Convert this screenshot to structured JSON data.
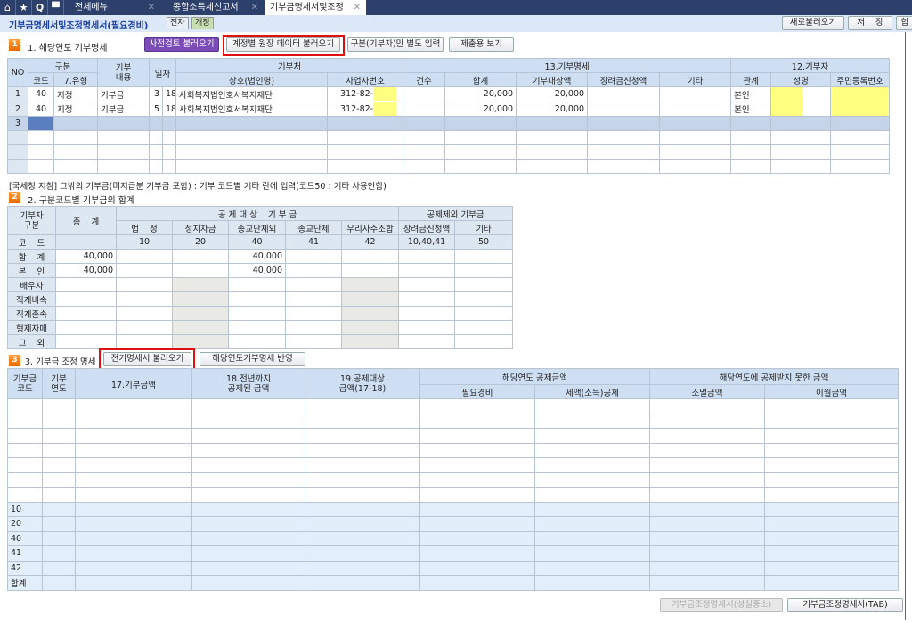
{
  "tabbar": {
    "icons": [
      "home-icon",
      "star-icon",
      "search-icon",
      "calendar-icon"
    ],
    "tabs": [
      {
        "label": "전체메뉴"
      },
      {
        "label": "종합소득세신고서"
      },
      {
        "label": "기부금명세서및조정"
      }
    ]
  },
  "header": {
    "title": "기부금명세서및조정명세서(필요경비)",
    "badge1": "전자",
    "badge2": "개정",
    "reload": "새로불러오기",
    "save": "저    장",
    "sum": "합"
  },
  "section1": {
    "no": "1",
    "title": "1. 해당연도 기부명세",
    "btn_precheck": "사전검토 불러오기",
    "btn_ledger": "계정별 원장 데이터 불러오기",
    "btn_separate": "구분(기부자)만 별도 입력",
    "btn_view": "제출용 보기",
    "headers": {
      "no": "NO",
      "gubun": "구분",
      "code": "코드",
      "type": "7.유형",
      "content": "기부\n내용",
      "date": "일자",
      "org": "기부처",
      "name": "상호(법인명)",
      "bizno": "사업자번호",
      "detail": "13.기부명세",
      "count": "건수",
      "total": "합계",
      "target": "기부대상액",
      "scholar": "장려금신청액",
      "etc": "기타",
      "donor": "12.기부자",
      "rel": "관계",
      "dname": "성명",
      "rrn": "주민등록번호"
    },
    "rows": [
      {
        "no": "1",
        "code": "40",
        "type": "지정",
        "content": "기부금",
        "month": "3",
        "day": "18",
        "name": "사회복지법인호서복지재단",
        "bizno": "312-82-",
        "count": "",
        "total": "20,000",
        "target": "20,000",
        "scholar": "",
        "etc": "",
        "rel": "본인"
      },
      {
        "no": "2",
        "code": "40",
        "type": "지정",
        "content": "기부금",
        "month": "5",
        "day": "18",
        "name": "사회복지법인호서복지재단",
        "bizno": "312-82-",
        "count": "",
        "total": "20,000",
        "target": "20,000",
        "scholar": "",
        "etc": "",
        "rel": "본인"
      },
      {
        "no": "3"
      }
    ]
  },
  "notice": "[국세청 지침] 그밖의 기부금(미지급분 기부금 포함) : 기부 코드별 기타 란에 입력(코드50 : 기타 사용안함)",
  "section2": {
    "no": "2",
    "title": "2. 구분코드별 기부금의 합계",
    "headers": {
      "donor": "기부자\n구분",
      "total": "총    계",
      "deductible": "공 제 대 상    기 부 금",
      "excluded": "공제제외 기부금",
      "cols": [
        "법    정",
        "정치자금",
        "종교단체외",
        "종교단체",
        "우리사주조합",
        "장려금신청액",
        "기타"
      ]
    },
    "code_label": "코    드",
    "codes": [
      "10",
      "20",
      "40",
      "41",
      "42",
      "10,40,41",
      "50"
    ],
    "rows": [
      {
        "label": "합    계",
        "vals": [
          "40,000",
          "",
          "",
          "40,000",
          "",
          "",
          "",
          ""
        ]
      },
      {
        "label": "본    인",
        "vals": [
          "40,000",
          "",
          "",
          "40,000",
          "",
          "",
          "",
          ""
        ]
      },
      {
        "label": "배우자",
        "vals": [
          "",
          "",
          "",
          "",
          "",
          "",
          "",
          ""
        ]
      },
      {
        "label": "직계비속",
        "vals": [
          "",
          "",
          "",
          "",
          "",
          "",
          "",
          ""
        ]
      },
      {
        "label": "직계존속",
        "vals": [
          "",
          "",
          "",
          "",
          "",
          "",
          "",
          ""
        ]
      },
      {
        "label": "형제자매",
        "vals": [
          "",
          "",
          "",
          "",
          "",
          "",
          "",
          ""
        ]
      },
      {
        "label": "그    외",
        "vals": [
          "",
          "",
          "",
          "",
          "",
          "",
          "",
          ""
        ]
      }
    ]
  },
  "section3": {
    "no": "3",
    "title": "3. 기부금 조정 명세",
    "btn_prev": "전기명세서 불러오기",
    "btn_apply": "해당연도기부명세 반영",
    "headers": {
      "code": "기부금\n코드",
      "year": "기부\n연도",
      "amount": "17.기부금액",
      "prior": "18.전년까지\n공제된 금액",
      "target": "19.공제대상\n금액(17-18)",
      "current": "해당연도 공제금액",
      "expense": "필요경비",
      "taxcredit": "세액(소득)공제",
      "notded": "해당연도에 공제받지 못한 금액",
      "expired": "소멸금액",
      "carry": "이월금액"
    },
    "summary_rows": [
      "10",
      "20",
      "40",
      "41",
      "42",
      "합계"
    ]
  },
  "footer": {
    "btn_sincere": "기부금조정명세서(성실중소)",
    "btn_tab": "기부금조정명세서(TAB)"
  }
}
